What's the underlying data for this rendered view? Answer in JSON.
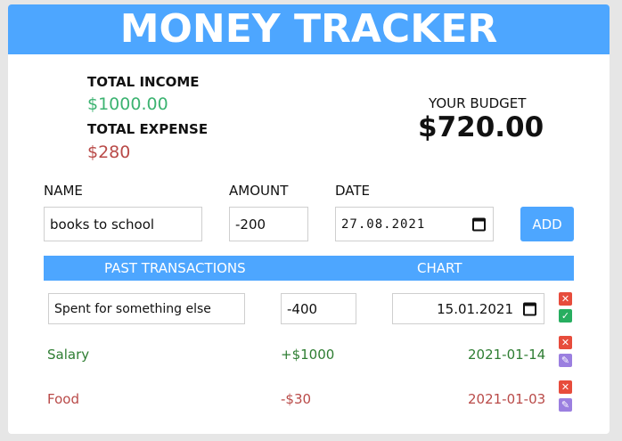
{
  "app": {
    "title": "MONEY TRACKER"
  },
  "summary": {
    "income_label": "TOTAL INCOME",
    "income_value": "$1000.00",
    "expense_label": "TOTAL EXPENSE",
    "expense_value": "$280",
    "budget_label": "YOUR BUDGET",
    "budget_value": "$720.00"
  },
  "form": {
    "name_label": "NAME",
    "amount_label": "AMOUNT",
    "date_label": "DATE",
    "name_value": "books to school",
    "amount_value": "-200",
    "date_value": "27.08.2021",
    "add_label": "ADD"
  },
  "tabs": {
    "past": "PAST TRANSACTIONS",
    "chart": "CHART"
  },
  "editing": {
    "name_value": "Spent for something else",
    "amount_value": "-400",
    "date_value": "15.01.2021"
  },
  "transactions": [
    {
      "name": "Salary",
      "amount": "+$1000",
      "date": "2021-01-14",
      "type": "income"
    },
    {
      "name": "Food",
      "amount": "-$30",
      "date": "2021-01-03",
      "type": "expense"
    }
  ],
  "colors": {
    "accent": "#4da6ff",
    "income": "#3cb371",
    "expense": "#b94a48"
  },
  "icons": {
    "delete": "close-icon",
    "confirm": "check-icon",
    "edit": "pencil-icon",
    "calendar": "calendar-icon"
  }
}
